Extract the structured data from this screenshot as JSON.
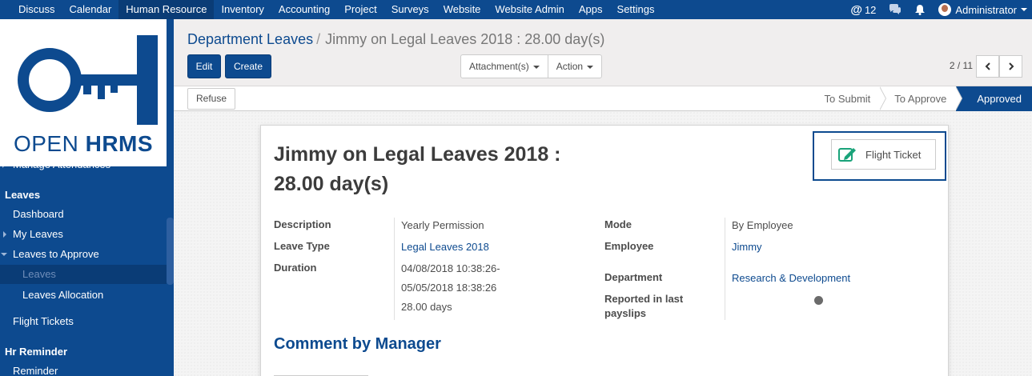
{
  "topbar": {
    "menu": [
      "Discuss",
      "Calendar",
      "Human Resource",
      "Inventory",
      "Accounting",
      "Project",
      "Surveys",
      "Website",
      "Website Admin",
      "Apps",
      "Settings"
    ],
    "active_menu": "Human Resource",
    "mentions_count": "12",
    "user": "Administrator"
  },
  "sidebar": {
    "brand_light": "OPEN",
    "brand_bold": "HRMS",
    "partial_item": "Manage Attendances",
    "leaves_header": "Leaves",
    "dashboard": "Dashboard",
    "my_leaves": "My Leaves",
    "leaves_to_approve": "Leaves to Approve",
    "leaves": "Leaves",
    "leaves_allocation": "Leaves Allocation",
    "flight_tickets": "Flight Tickets",
    "hr_reminder_header": "Hr Reminder",
    "reminder": "Reminder"
  },
  "breadcrumb": {
    "parent": "Department Leaves",
    "separator": "/",
    "current": "Jimmy on Legal Leaves 2018 : 28.00 day(s)"
  },
  "buttons": {
    "edit": "Edit",
    "create": "Create",
    "attachments": "Attachment(s)",
    "action": "Action",
    "refuse": "Refuse"
  },
  "pager": {
    "value": "2 / 11"
  },
  "statusbar": {
    "to_submit": "To Submit",
    "to_approve": "To Approve",
    "approved": "Approved"
  },
  "form": {
    "title_line1": "Jimmy on Legal Leaves 2018 :",
    "title_line2": "28.00 day(s)",
    "smart_button": "Flight Ticket",
    "description_label": "Description",
    "description": "Yearly Permission",
    "leave_type_label": "Leave Type",
    "leave_type": "Legal Leaves 2018",
    "duration_label": "Duration",
    "duration_from": "04/08/2018 10:38:26-",
    "duration_to": "05/05/2018 18:38:26",
    "duration_days": "28.00 days",
    "mode_label": "Mode",
    "mode": "By Employee",
    "employee_label": "Employee",
    "employee": "Jimmy",
    "department_label": "Department",
    "department": "Research & Development",
    "reported_label_1": "Reported in last",
    "reported_label_2": "payslips",
    "comment_title": "Comment by Manager"
  },
  "colors": {
    "brand": "#0d4a8f",
    "active_nav": "#0a3c76"
  }
}
